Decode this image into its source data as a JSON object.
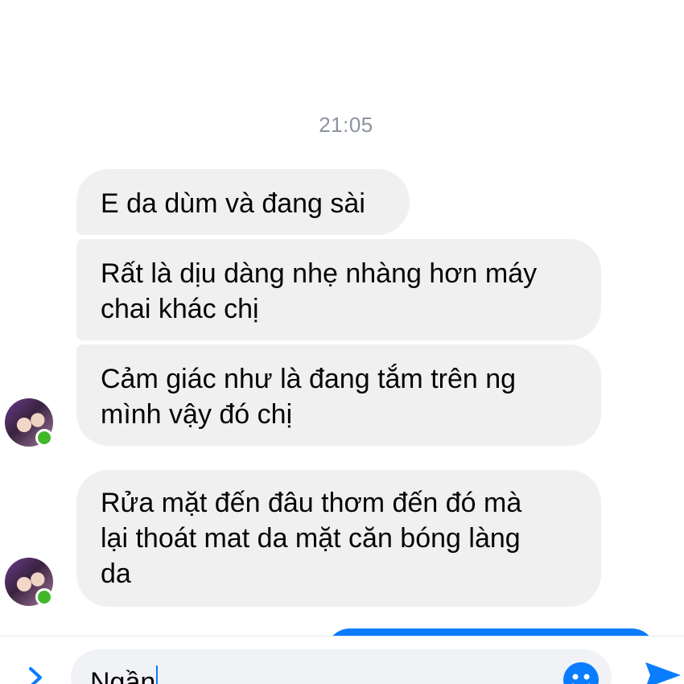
{
  "conversation": {
    "timestamp": "21:05",
    "messages": [
      {
        "lines": [
          "E da dùm và đang sài"
        ]
      },
      {
        "lines": [
          "Rất là dịu dàng nhẹ nhàng hơn máy",
          "chai khác chị"
        ]
      },
      {
        "lines": [
          "Cảm giác như là đang tắm trên ng",
          "mình vậy đó chị"
        ]
      },
      {
        "lines": [
          "Rửa mặt đến đâu thơm đến đó mà",
          "lại thoát mat da mặt căn bóng làng",
          "da"
        ]
      }
    ]
  },
  "composer": {
    "input_value": "Ngần",
    "icons": {
      "expand": "chevron-right-icon",
      "emoji": "emoji-icon",
      "send": "send-icon"
    }
  },
  "colors": {
    "received_bubble": "#f1f0f0",
    "sent_bubble": "#0a7cff",
    "accent": "#0a7cff",
    "online": "#42b72a",
    "timestamp": "#8d949e"
  }
}
